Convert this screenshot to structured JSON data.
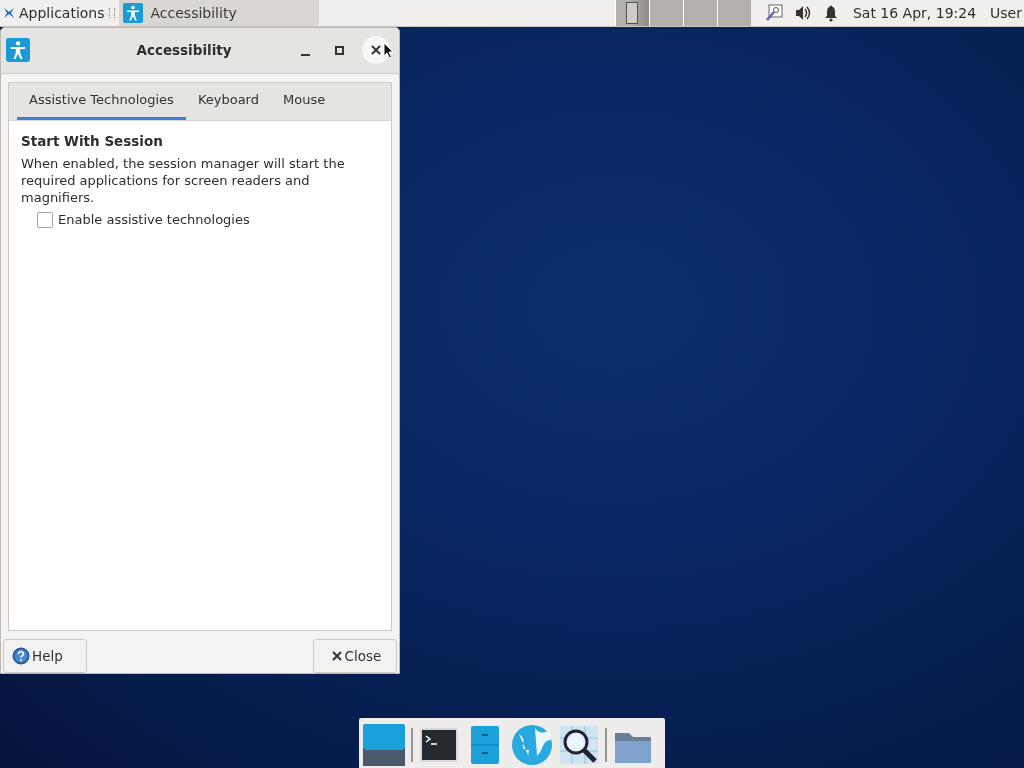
{
  "panel": {
    "app_menu": "Applications",
    "task": {
      "label": "Accessibility",
      "selected": true
    },
    "workspaces": [
      {
        "selected": true
      },
      {
        "selected": false
      },
      {
        "selected": false
      },
      {
        "selected": false
      }
    ],
    "clock": "Sat 16 Apr, 19:24",
    "user": "User"
  },
  "window": {
    "title": "Accessibility",
    "tabs": [
      {
        "label": "Assistive Technologies",
        "selected": true
      },
      {
        "label": "Keyboard",
        "selected": false
      },
      {
        "label": "Mouse",
        "selected": false
      }
    ],
    "section_title": "Start With Session",
    "description": "When enabled, the session manager will start the required applications for screen readers and magnifiers.",
    "checkbox": {
      "label": "Enable assistive technologies",
      "checked": false
    },
    "buttons": [
      {
        "kind": "help",
        "label": "Help"
      },
      {
        "kind": "close",
        "label": "Close"
      }
    ]
  }
}
